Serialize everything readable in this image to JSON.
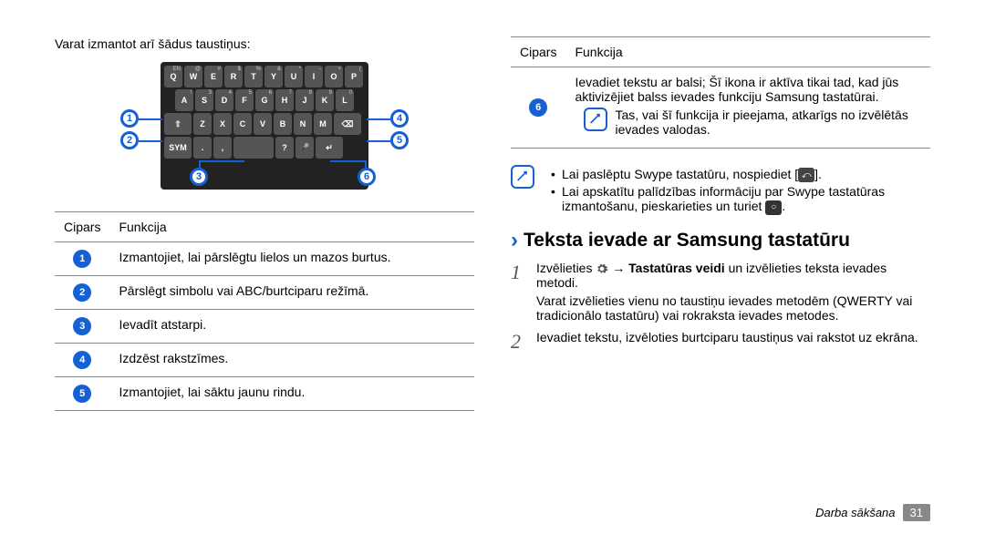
{
  "left": {
    "intro": "Varat izmantot arī šādus taustiņus:",
    "keyboard_rows": [
      [
        "Q",
        "W",
        "E",
        "R",
        "T",
        "Y",
        "U",
        "I",
        "O",
        "P"
      ],
      [
        "A",
        "S",
        "D",
        "F",
        "G",
        "H",
        "J",
        "K",
        "L"
      ],
      [
        "⇧",
        "Z",
        "X",
        "C",
        "V",
        "B",
        "N",
        "M",
        "⌫"
      ],
      [
        "SYM",
        ".",
        ",",
        "␣",
        "?",
        "🎤",
        "↵"
      ]
    ],
    "key_sups_row0": [
      "EN",
      "@",
      "#",
      "$",
      "%",
      "&",
      "*",
      "-",
      "+",
      "("
    ],
    "key_sups_row1": [
      "!",
      "3",
      "4",
      "5",
      "6",
      "7",
      "8",
      "9",
      "0"
    ],
    "table_header": {
      "col1": "Cipars",
      "col2": "Funkcija"
    },
    "rows": [
      {
        "n": "1",
        "text": "Izmantojiet, lai pārslēgtu lielos un mazos burtus."
      },
      {
        "n": "2",
        "text": "Pārslēgt simbolu vai ABC/burtciparu režīmā."
      },
      {
        "n": "3",
        "text": "Ievadīt atstarpi."
      },
      {
        "n": "4",
        "text": "Izdzēst rakstzīmes."
      },
      {
        "n": "5",
        "text": "Izmantojiet, lai sāktu jaunu rindu."
      }
    ]
  },
  "right": {
    "table_header": {
      "col1": "Cipars",
      "col2": "Funkcija"
    },
    "row6": {
      "n": "6",
      "text": "Ievadiet tekstu ar balsi; Šī ikona ir aktīva tikai tad, kad jūs aktivizējiet balss ievades funkciju Samsung tastatūrai.",
      "note": "Tas, vai šī funkcija ir pieejama, atkarīgs no izvēlētās ievades valodas."
    },
    "bullets": {
      "b1_pre": "Lai paslēptu Swype tastatūru, nospiediet [",
      "b1_post": "].",
      "b2_pre": "Lai apskatītu palīdzības informāciju par Swype tastatūras izmantošanu, pieskarieties un turiet ",
      "b2_post": "."
    },
    "heading": "Teksta ievade ar Samsung tastatūru",
    "steps": {
      "s1_pre": "Izvēlieties ",
      "s1_mid": " → ",
      "s1_bold": "Tastatūras veidi",
      "s1_post": " un izvēlieties teksta ievades metodi.",
      "s1_sub": "Varat izvēlieties vienu no taustiņu ievades metodēm (QWERTY vai tradicionālo tastatūru) vai rokraksta ievades metodes.",
      "s2": "Ievadiet tekstu, izvēloties burtciparu taustiņus vai rakstot uz ekrāna."
    }
  },
  "footer": {
    "section": "Darba sākšana",
    "page": "31"
  }
}
